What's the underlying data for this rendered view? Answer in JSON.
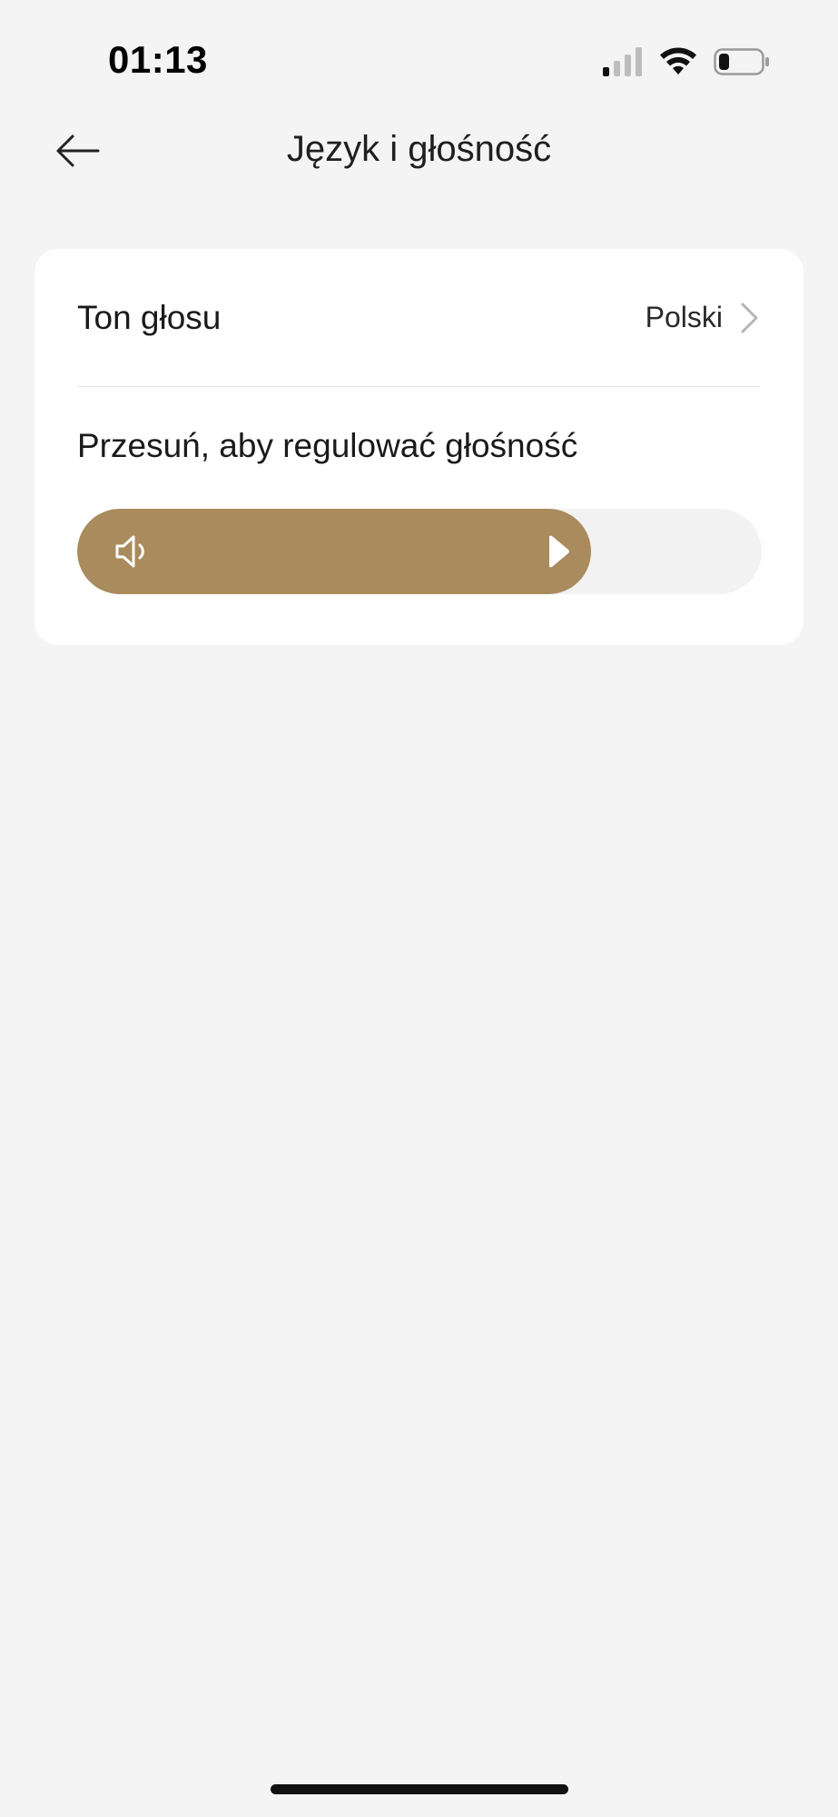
{
  "status_bar": {
    "time": "01:13",
    "icons": [
      "signal-icon",
      "wifi-icon",
      "battery-icon"
    ]
  },
  "header": {
    "back_icon": "arrow-left-icon",
    "title": "Język i głośność"
  },
  "settings": {
    "voice_tone": {
      "label": "Ton głosu",
      "value": "Polski",
      "icon": "chevron-right-icon"
    },
    "volume": {
      "label": "Przesuń, aby regulować głośność",
      "level_fraction": 0.75,
      "icon": "speaker-icon"
    }
  },
  "colors": {
    "accent": "#aa8b5e",
    "background": "#f4f4f4",
    "card": "#ffffff",
    "track": "#f2f2f2"
  }
}
